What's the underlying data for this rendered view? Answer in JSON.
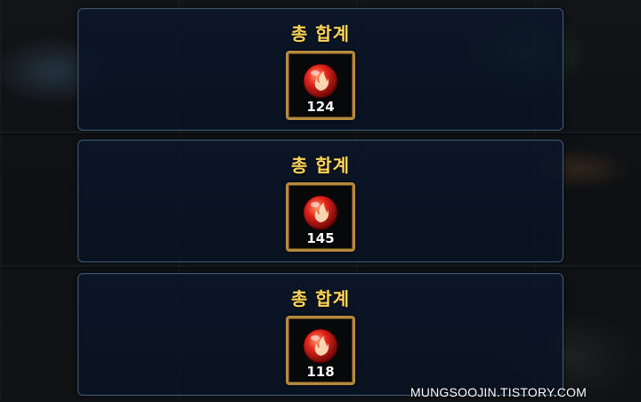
{
  "colors": {
    "title": "#ffd55a",
    "panel_border": "#3d5670",
    "slot_border": "#b58a3c",
    "orb": "#e0241a"
  },
  "panels": [
    {
      "title": "총 합계",
      "item_icon": "fire-orb-icon",
      "count": "124"
    },
    {
      "title": "총 합계",
      "item_icon": "fire-orb-icon",
      "count": "145"
    },
    {
      "title": "총 합계",
      "item_icon": "fire-orb-icon",
      "count": "118"
    }
  ],
  "watermark": "MUNGSOOJIN.TISTORY.COM"
}
